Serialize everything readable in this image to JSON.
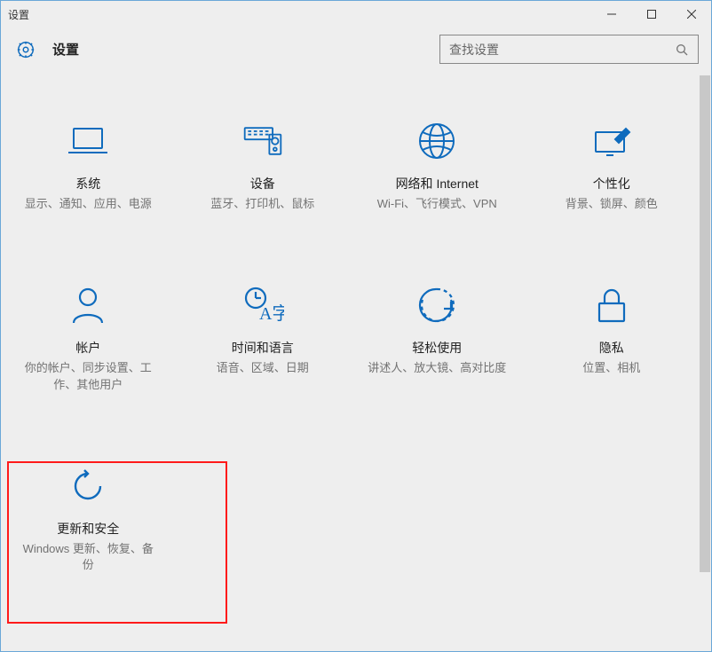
{
  "window": {
    "title": "设置"
  },
  "header": {
    "title": "设置"
  },
  "search": {
    "placeholder": "查找设置"
  },
  "tiles": [
    {
      "title": "系统",
      "desc": "显示、通知、应用、电源"
    },
    {
      "title": "设备",
      "desc": "蓝牙、打印机、鼠标"
    },
    {
      "title": "网络和 Internet",
      "desc": "Wi-Fi、飞行模式、VPN"
    },
    {
      "title": "个性化",
      "desc": "背景、锁屏、颜色"
    },
    {
      "title": "帐户",
      "desc": "你的帐户、同步设置、工作、其他用户"
    },
    {
      "title": "时间和语言",
      "desc": "语音、区域、日期"
    },
    {
      "title": "轻松使用",
      "desc": "讲述人、放大镜、高对比度"
    },
    {
      "title": "隐私",
      "desc": "位置、相机"
    },
    {
      "title": "更新和安全",
      "desc": "Windows 更新、恢复、备份"
    }
  ]
}
